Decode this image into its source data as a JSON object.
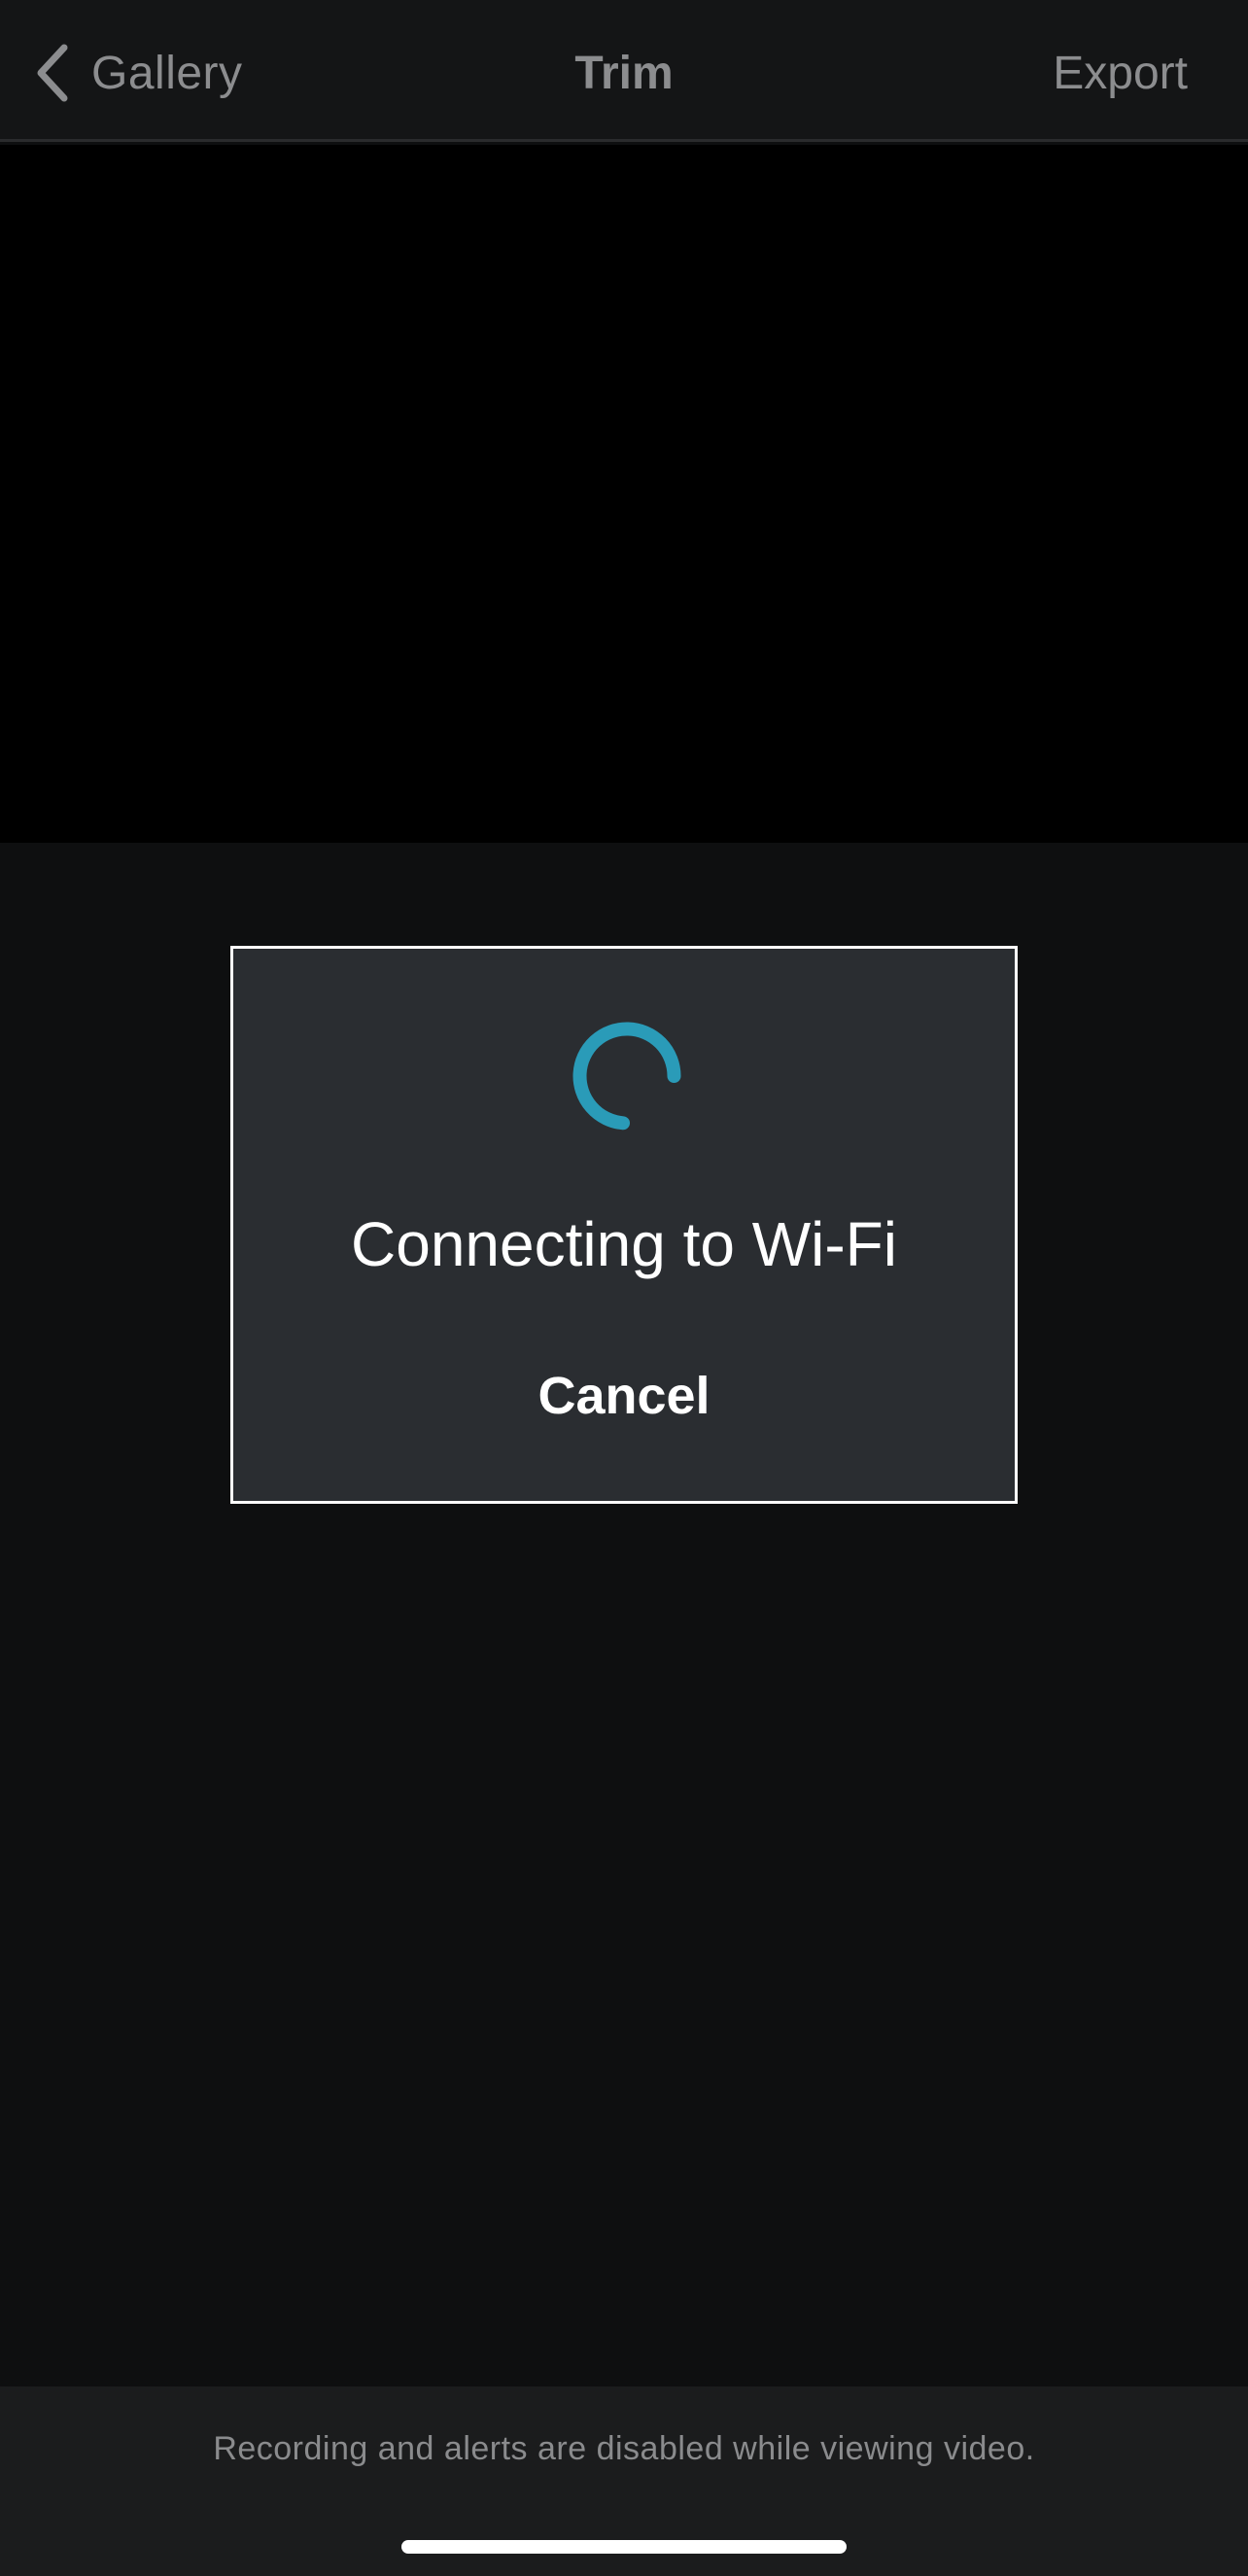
{
  "nav": {
    "back_label": "Gallery",
    "title": "Trim",
    "export_label": "Export"
  },
  "dialog": {
    "message": "Connecting to Wi-Fi",
    "cancel_label": "Cancel",
    "spinner_color": "#2a9bb8"
  },
  "footer": {
    "note": "Recording and alerts are disabled while viewing video."
  },
  "colors": {
    "background": "#0e0f10",
    "topbar": "#141516",
    "dialog_bg": "#2a2d31",
    "accent": "#2a9bb8",
    "muted_text": "#8c8d8f"
  }
}
